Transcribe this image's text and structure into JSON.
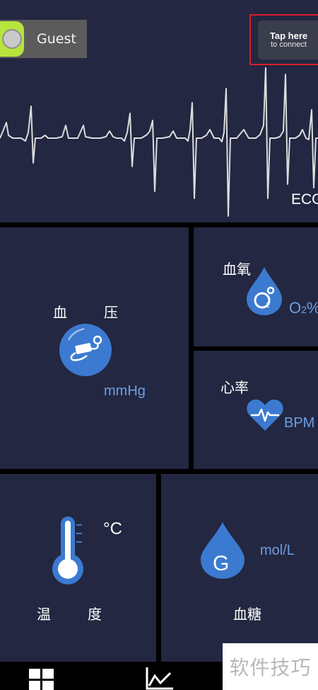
{
  "header": {
    "user_name": "Guest",
    "connect_line1": "Tap here",
    "connect_line2": "to connect",
    "ecg_label": "ECG"
  },
  "tiles": {
    "blood_pressure": {
      "label_a": "血",
      "label_b": "压",
      "unit": "mmHg",
      "icon": "blood-pressure-cuff-icon"
    },
    "spo2": {
      "label": "血氧",
      "unit_main": "O",
      "unit_sub": "2",
      "unit_tail": "%",
      "icon": "oxygen-drop-icon"
    },
    "heart_rate": {
      "label": "心率",
      "unit": "BPM",
      "icon": "heart-pulse-icon"
    },
    "temperature": {
      "label_a": "温",
      "label_b": "度",
      "unit": "°C",
      "icon": "thermometer-icon"
    },
    "glucose": {
      "label": "血糖",
      "unit": "mol/L",
      "icon_letter": "G",
      "icon": "glucose-drop-icon"
    }
  },
  "tabbar": {
    "items": [
      "dashboard-grid-icon",
      "trend-chart-icon"
    ]
  },
  "watermark": {
    "text": "软件技巧"
  },
  "colors": {
    "panel": "#232741",
    "accent_blue": "#3b7ad0",
    "unit_blue": "#6d9ee3",
    "connect_border": "#d81e2b",
    "avatar_green": "#b7e43e"
  }
}
